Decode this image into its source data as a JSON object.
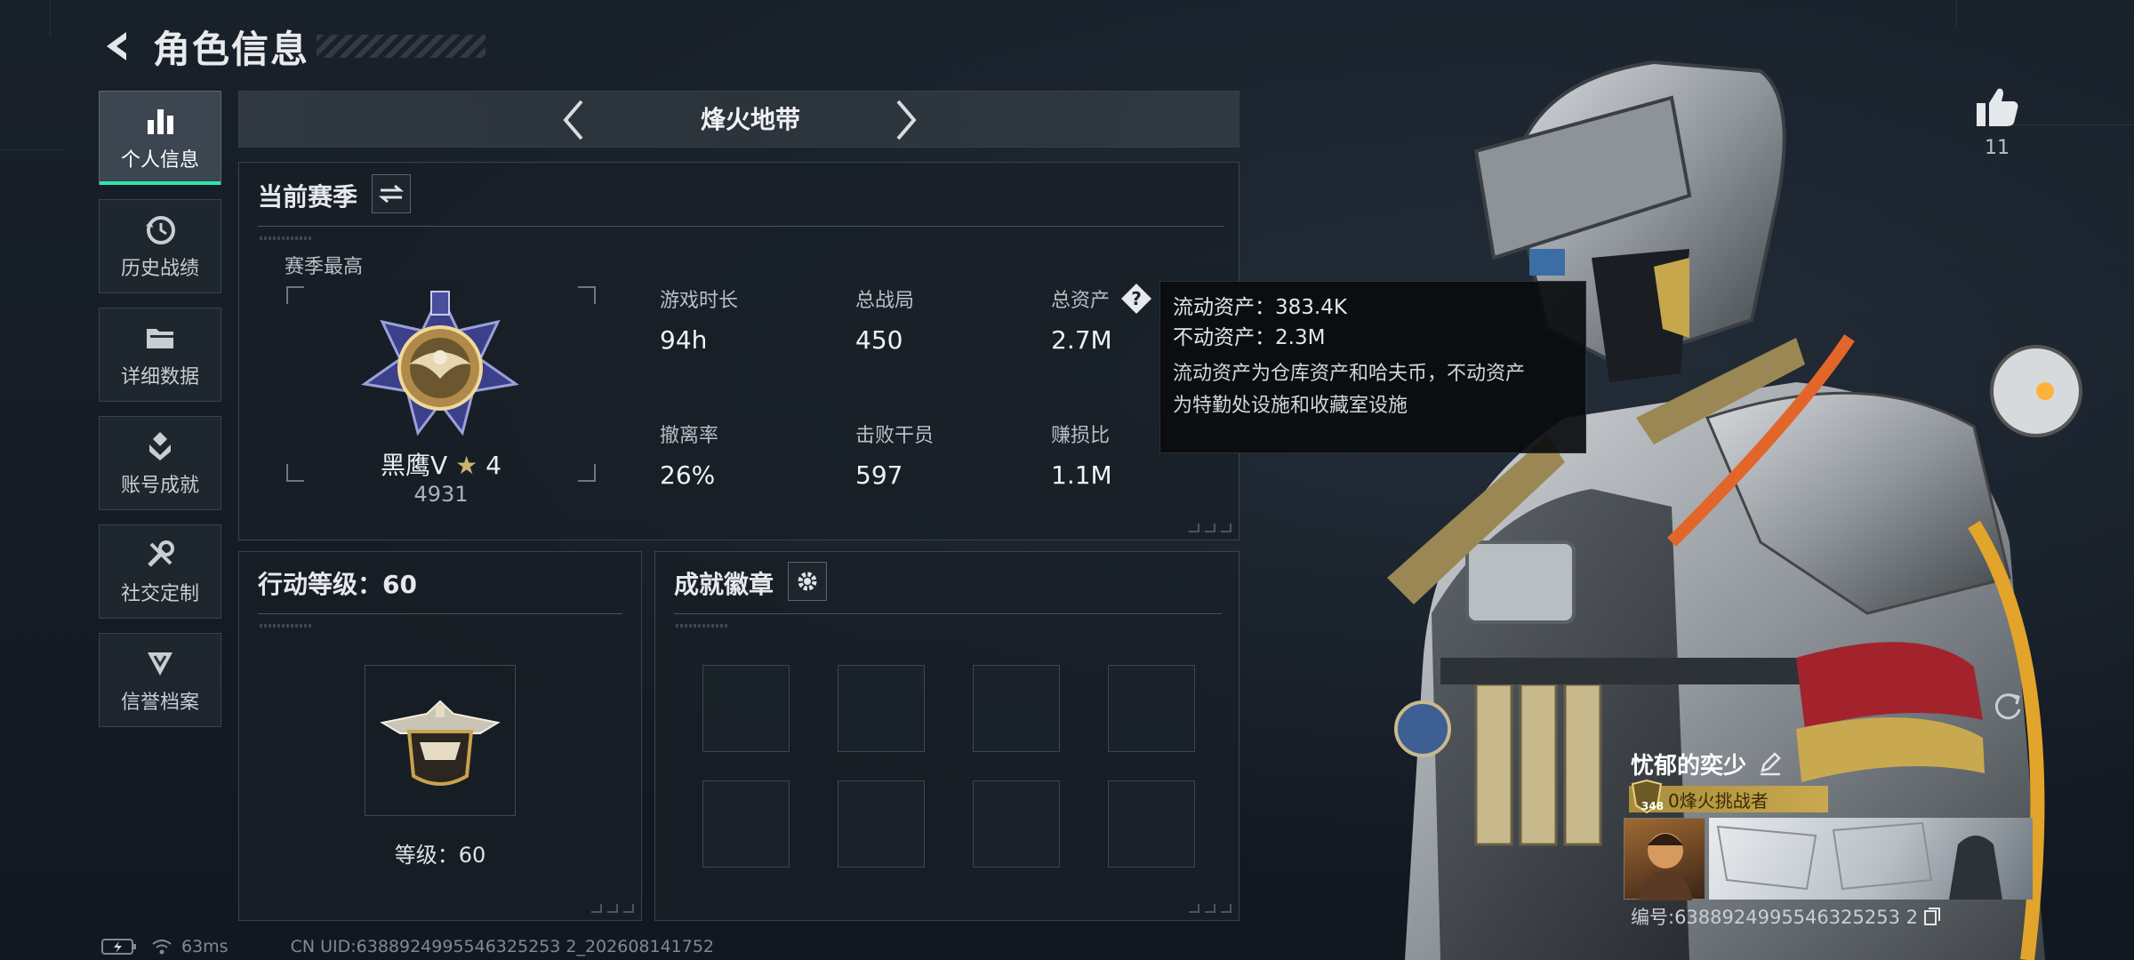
{
  "header": {
    "title": "角色信息",
    "back_icon": "back-arrow-icon"
  },
  "sidebar": {
    "items": [
      {
        "label": "个人信息",
        "icon": "bar-chart-icon",
        "active": true
      },
      {
        "label": "历史战绩",
        "icon": "history-clock-icon",
        "active": false
      },
      {
        "label": "详细数据",
        "icon": "folder-icon",
        "active": false
      },
      {
        "label": "账号成就",
        "icon": "achievement-icon",
        "active": false
      },
      {
        "label": "社交定制",
        "icon": "tools-icon",
        "active": false
      },
      {
        "label": "信誉档案",
        "icon": "reputation-icon",
        "active": false
      }
    ]
  },
  "mode": {
    "title": "烽火地带"
  },
  "season": {
    "title": "当前赛季",
    "best_label": "赛季最高",
    "rank_name": "黑鹰V",
    "rank_star": "★",
    "rank_stars": "4",
    "rank_score": "4931",
    "stats": [
      {
        "key": "游戏时长",
        "value": "94h"
      },
      {
        "key": "总战局",
        "value": "450"
      },
      {
        "key": "总资产",
        "value": "2.7M"
      },
      {
        "key": "撤离率",
        "value": "26%"
      },
      {
        "key": "击败干员",
        "value": "597"
      },
      {
        "key": "赚损比",
        "value": "1.1M"
      }
    ]
  },
  "tooltip": {
    "liquid": "流动资产：383.4K",
    "fixed": "不动资产：2.3M",
    "desc_line1": "流动资产为仓库资产和哈夫币，不动资产",
    "desc_line2": "为特勤处设施和收藏室设施"
  },
  "level": {
    "title": "行动等级：60",
    "label": "等级：60"
  },
  "achievements": {
    "title": "成就徽章",
    "slots": 8
  },
  "likes": {
    "count": "11"
  },
  "card": {
    "name": "忧郁的奕少",
    "title_text": "0烽火挑战者",
    "badge_level": "348",
    "id_text": "编号:6388924995546325253 2"
  },
  "status": {
    "ping": "63ms",
    "uid": "CN UID:6388924995546325253 2_202608141752"
  },
  "colors": {
    "accent": "#2ee6a8",
    "gold": "#c9a94f",
    "bg": "#151b22"
  }
}
